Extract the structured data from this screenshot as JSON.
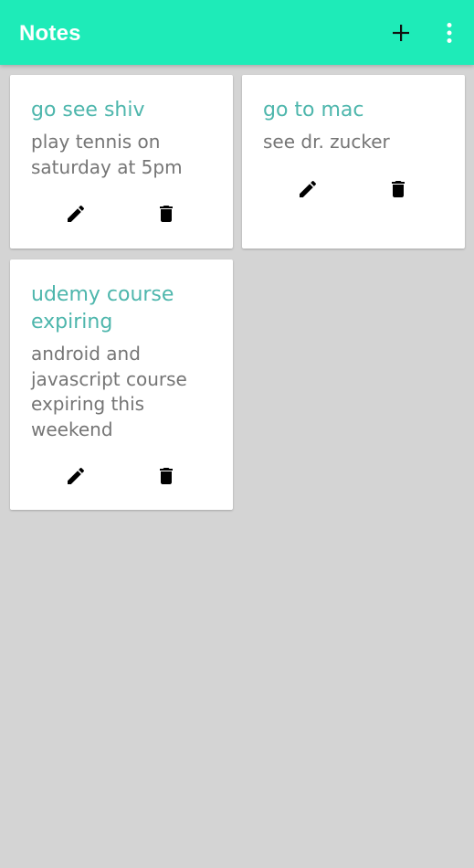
{
  "app": {
    "title": "Notes",
    "accent_color": "#1eebb8",
    "actions": [
      {
        "icon": "add-icon"
      },
      {
        "icon": "more-vert-icon"
      }
    ]
  },
  "notes": [
    {
      "title": "go see shiv",
      "body": "play tennis on saturday at 5pm",
      "edit_icon": "edit-icon",
      "delete_icon": "delete-icon"
    },
    {
      "title": "go to mac",
      "body": "see dr. zucker",
      "edit_icon": "edit-icon",
      "delete_icon": "delete-icon"
    },
    {
      "title": "udemy course expiring",
      "body": "android and javascript course expiring this weekend",
      "edit_icon": "edit-icon",
      "delete_icon": "delete-icon"
    }
  ],
  "colors": {
    "background": "#d4d4d4",
    "title_text": "#4db6ac",
    "body_text": "#757575"
  }
}
